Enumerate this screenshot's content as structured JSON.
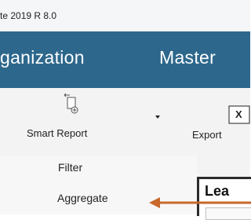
{
  "window": {
    "title": "te 2019 R 8.0"
  },
  "menu": {
    "items": [
      "ganization",
      "Master"
    ]
  },
  "ribbon": {
    "smart_report_label": "Smart Report",
    "export_label": "Export",
    "export_icon_letter": "X"
  },
  "submenu": {
    "items": [
      "Filter",
      "Aggregate"
    ]
  },
  "panel": {
    "title": "Lea"
  },
  "annotation": {
    "arrow_color": "#c8682a",
    "arrow_direction": "left"
  }
}
